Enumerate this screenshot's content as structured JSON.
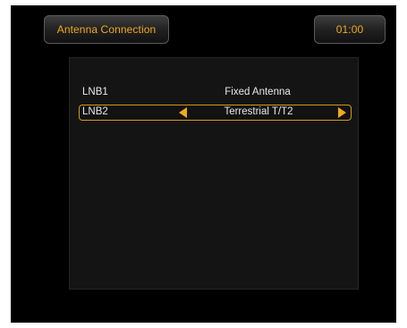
{
  "header": {
    "title": "Antenna Connection",
    "clock": "01:00"
  },
  "rows": [
    {
      "label": "LNB1",
      "value": "Fixed Antenna",
      "selected": false
    },
    {
      "label": "LNB2",
      "value": "Terrestrial T/T2",
      "selected": true
    }
  ],
  "colors": {
    "accent": "#f0a820",
    "background": "#000000",
    "panel": "#141414",
    "text": "#e8e8e8",
    "selection_border": "#d49a1c"
  },
  "icons": {
    "left_arrow": "triangle-left-icon",
    "right_arrow": "triangle-right-icon"
  }
}
